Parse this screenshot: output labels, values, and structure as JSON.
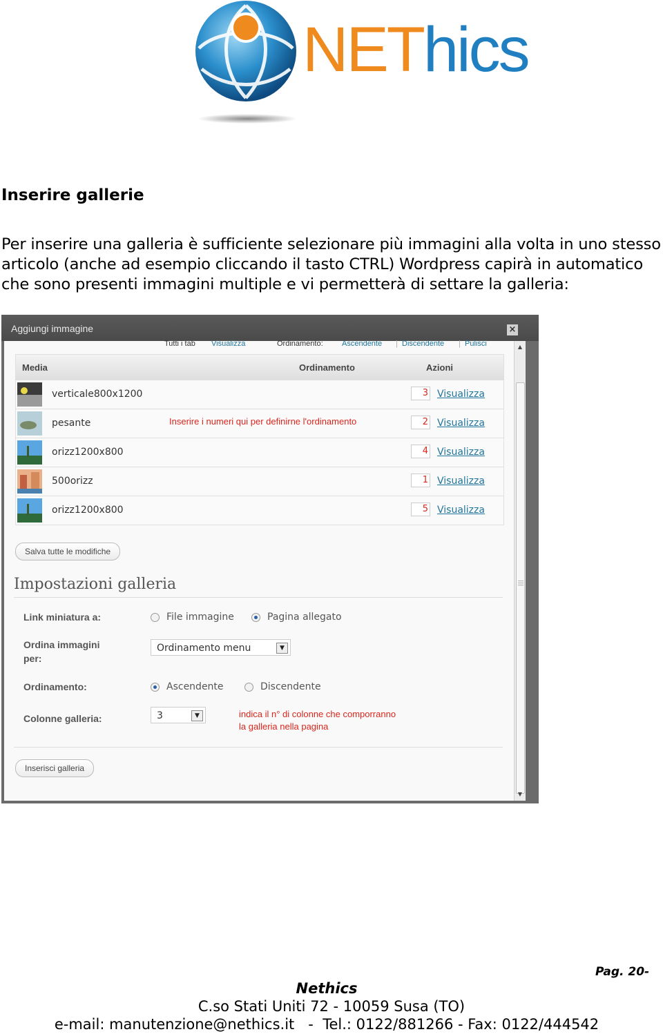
{
  "logo": {
    "text_part1": "NET",
    "text_part2": "hics",
    "colors": {
      "orange": "#ef8a1e",
      "blue": "#1f7fc0"
    }
  },
  "document": {
    "title": "Inserire gallerie",
    "paragraph": "Per inserire una galleria è sufficiente selezionare più immagini alla volta in uno stesso articolo (anche ad esempio cliccando il tasto CTRL) Wordpress capirà in automatico che sono presenti immagini multiple e vi permetterà di settare la galleria:"
  },
  "dialog": {
    "title": "Aggiungi immagine",
    "close_icon": "close-icon",
    "filters": {
      "all_tabs": "Tutti i tab",
      "show": "Visualizza",
      "ordering_label": "Ordinamento:",
      "ascending": "Ascendente",
      "descending": "Discendente",
      "clear": "Pulisci"
    },
    "table": {
      "columns": [
        "Media",
        "Ordinamento",
        "Azioni"
      ],
      "rows": [
        {
          "name": "verticale800x1200",
          "order": "3",
          "action": "Visualizza"
        },
        {
          "name": "pesante",
          "order": "2",
          "action": "Visualizza",
          "note": "Inserire i numeri qui per definirne l'ordinamento"
        },
        {
          "name": "orizz1200x800",
          "order": "4",
          "action": "Visualizza"
        },
        {
          "name": "500orizz",
          "order": "1",
          "action": "Visualizza"
        },
        {
          "name": "orizz1200x800",
          "order": "5",
          "action": "Visualizza"
        }
      ]
    },
    "save_button": "Salva tutte le modifiche",
    "gallery_settings": {
      "heading": "Impostazioni galleria",
      "link_label": "Link miniatura a:",
      "link_options": [
        "File immagine",
        "Pagina allegato"
      ],
      "link_selected": "Pagina allegato",
      "order_by_label_1": "Ordina immagini",
      "order_by_label_2": "per:",
      "order_by_value": "Ordinamento menu",
      "order_label": "Ordinamento:",
      "order_options": [
        "Ascendente",
        "Discendente"
      ],
      "order_selected": "Ascendente",
      "columns_label": "Colonne galleria:",
      "columns_value": "3",
      "columns_note_1": "indica il n° di colonne che comporranno",
      "columns_note_2": "la galleria nella pagina"
    },
    "insert_button": "Inserisci galleria"
  },
  "footer": {
    "page": "Pag. 20-",
    "company": "Nethics",
    "address": "C.so Stati Uniti 72 - 10059 Susa (TO)",
    "contact": "e-mail: manutenzione@nethics.it   -  Tel.: 0122/881266 - Fax: 0122/444542"
  }
}
